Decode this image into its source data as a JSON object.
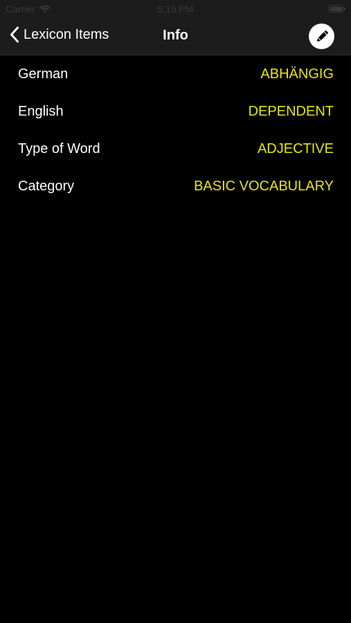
{
  "status_bar": {
    "carrier": "Carrier",
    "time": "5:19 PM"
  },
  "nav": {
    "back_label": "Lexicon Items",
    "title": "Info"
  },
  "rows": [
    {
      "label": "German",
      "value": "ABHÄNGIG"
    },
    {
      "label": "English",
      "value": "DEPENDENT"
    },
    {
      "label": "Type of Word",
      "value": "ADJECTIVE"
    },
    {
      "label": "Category",
      "value": "BASIC VOCABULARY"
    }
  ],
  "colors": {
    "value_accent": "#e8e60a",
    "background": "#000000",
    "bar": "#1c1c1c"
  },
  "icons": {
    "back": "chevron-left-icon",
    "edit": "pencil-icon",
    "wifi": "wifi-icon",
    "battery": "battery-icon"
  }
}
